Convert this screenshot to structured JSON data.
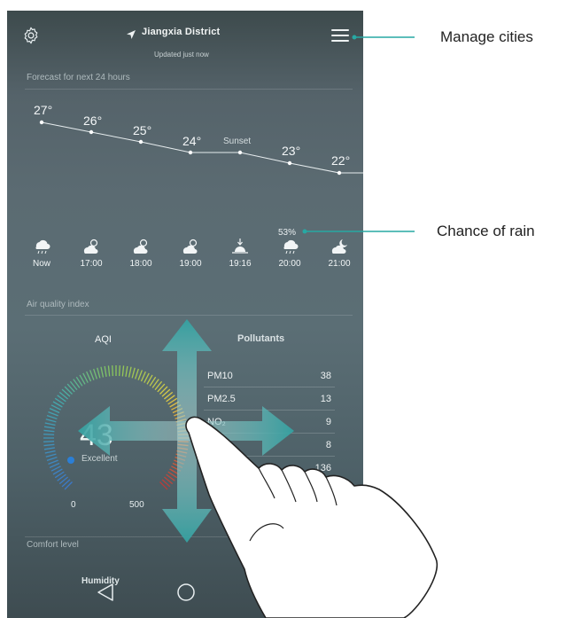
{
  "header": {
    "city": "Jiangxia District",
    "updated": "Updated just now",
    "settings_icon": "gear-icon",
    "location_icon": "location-arrow-icon",
    "menu_icon": "hamburger-menu-icon"
  },
  "forecast": {
    "title": "Forecast for next 24 hours",
    "temps": [
      "27°",
      "26°",
      "25°",
      "24°",
      "23°",
      "22°"
    ],
    "sunset_label": "Sunset",
    "rain_chance": "53%",
    "hours": [
      "Now",
      "17:00",
      "18:00",
      "19:00",
      "19:16",
      "20:00",
      "21:00"
    ],
    "icons": [
      "cloud-rain-icon",
      "partly-cloudy-icon",
      "partly-cloudy-icon",
      "partly-cloudy-icon",
      "sunset-icon",
      "cloud-rain-icon",
      "partly-cloudy-night-icon"
    ]
  },
  "air_quality": {
    "title": "Air quality index",
    "aqi_label": "AQI",
    "aqi_value": "43",
    "status": "Excellent",
    "gauge_min": "0",
    "gauge_max": "500",
    "aqi_level": 0.086,
    "pollutants_title": "Pollutants",
    "pollutants": [
      {
        "name": "PM10",
        "value": "38"
      },
      {
        "name": "PM2.5",
        "value": "13"
      },
      {
        "name": "NO₂",
        "value": "9"
      },
      {
        "name": "",
        "value": "8"
      },
      {
        "name": "O",
        "value": "136"
      },
      {
        "name": "CO",
        "value": ""
      }
    ]
  },
  "comfort": {
    "title": "Comfort level",
    "humidity_label": "Humidity"
  },
  "navbar": {
    "back_icon": "back-triangle-icon",
    "home_icon": "home-circle-icon",
    "recent_icon": "recent-square-icon"
  },
  "annotations": {
    "manage_cities": "Manage cities",
    "chance_of_rain": "Chance of rain"
  },
  "colors": {
    "arrow_fill": "#3aa3a3",
    "callout_line": "#27a8a3",
    "dot_blue": "#2b7fd6"
  }
}
